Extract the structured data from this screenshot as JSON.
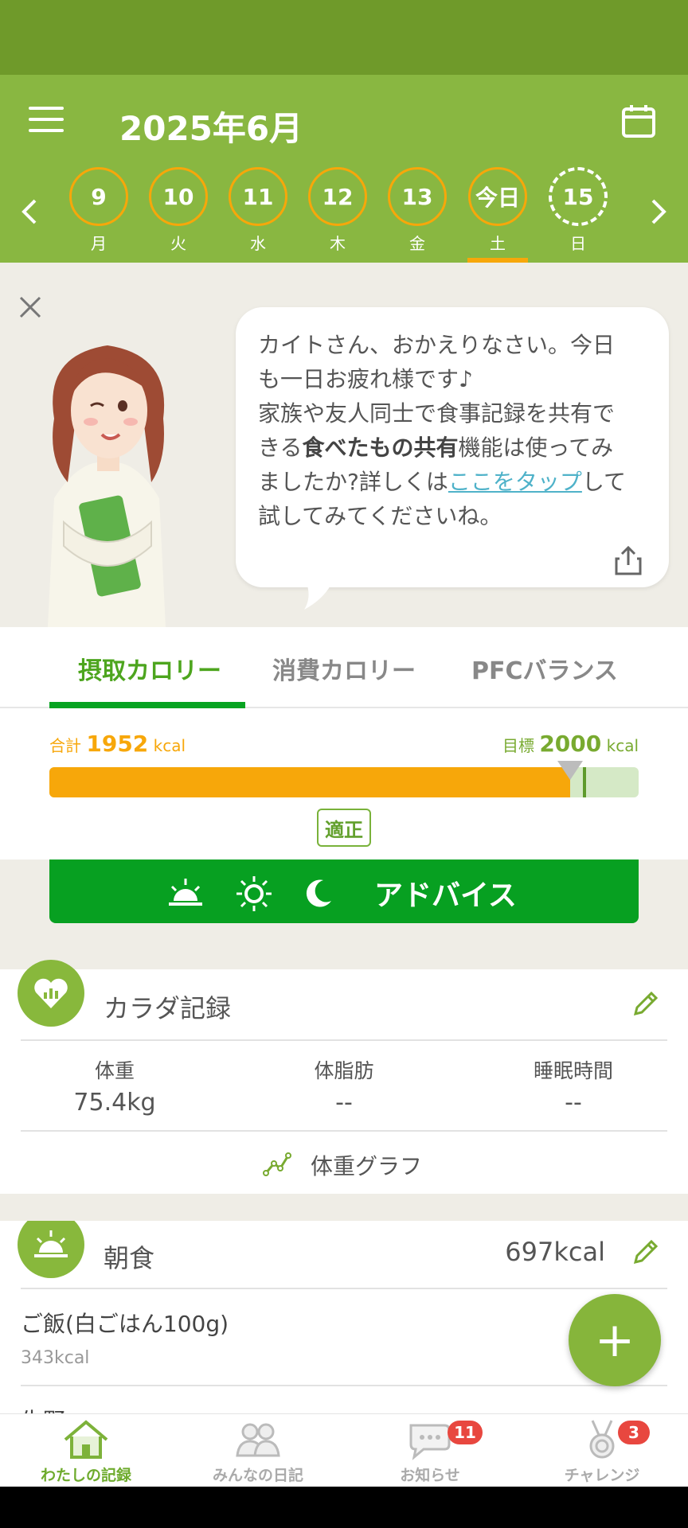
{
  "header": {
    "month": "2025年6月",
    "days": [
      {
        "num": "9",
        "wk": "月"
      },
      {
        "num": "10",
        "wk": "火"
      },
      {
        "num": "11",
        "wk": "水"
      },
      {
        "num": "12",
        "wk": "木"
      },
      {
        "num": "13",
        "wk": "金"
      },
      {
        "num": "今日",
        "wk": "土"
      },
      {
        "num": "15",
        "wk": "日"
      }
    ]
  },
  "advisor": {
    "line1": "カイトさん、おかえりなさい。今日",
    "line2": "も一日お疲れ様です♪",
    "line3": "家族や友人同士で食事記録を共有で",
    "line4a": "きる",
    "line4b": "食べたもの共有",
    "line4c": "機能は使ってみ",
    "line5a": "ましたか?詳しくは",
    "line5b": "ここをタップ",
    "line5c": "して",
    "line6": "試してみてくださいね。"
  },
  "tabs": {
    "intake": "摂取カロリー",
    "burn": "消費カロリー",
    "pfc": "PFCバランス"
  },
  "calorie": {
    "total_label": "合計",
    "total": "1952",
    "target_label": "目標",
    "target": "2000",
    "unit": "kcal",
    "progress": 0.976,
    "status": "適正"
  },
  "advice_label": "アドバイス",
  "body": {
    "title": "カラダ記録",
    "weight_label": "体重",
    "weight": "75.4kg",
    "fat_label": "体脂肪",
    "fat": "--",
    "sleep_label": "睡眠時間",
    "sleep": "--",
    "graph_label": "体重グラフ"
  },
  "breakfast": {
    "title": "朝食",
    "kcal": "697kcal",
    "items": [
      {
        "name": "ご飯(白ごはん100g)",
        "kcal": "343kcal"
      },
      {
        "name": "生野",
        "kcal": ""
      }
    ]
  },
  "nav": {
    "home": "わたしの記録",
    "diary": "みんなの日記",
    "news": "お知らせ",
    "news_badge": "11",
    "challenge": "チャレンジ",
    "challenge_badge": "3"
  },
  "colors": {
    "header": "#89b741",
    "accent": "#f7a70a",
    "green": "#07a021"
  }
}
